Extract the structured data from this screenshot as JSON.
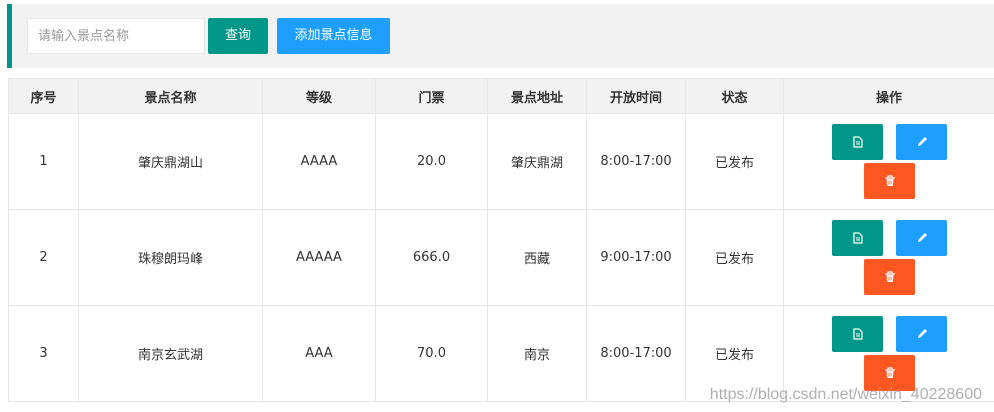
{
  "toolbar": {
    "search_placeholder": "请输入景点名称",
    "query_label": "查询",
    "add_label": "添加景点信息"
  },
  "table": {
    "headers": [
      "序号",
      "景点名称",
      "等级",
      "门票",
      "景点地址",
      "开放时间",
      "状态",
      "操作"
    ],
    "rows": [
      {
        "no": "1",
        "name": "肇庆鼎湖山",
        "level": "AAAA",
        "ticket": "20.0",
        "address": "肇庆鼎湖",
        "hours": "8:00-17:00",
        "status": "已发布"
      },
      {
        "no": "2",
        "name": "珠穆朗玛峰",
        "level": "AAAAA",
        "ticket": "666.0",
        "address": "西藏",
        "hours": "9:00-17:00",
        "status": "已发布"
      },
      {
        "no": "3",
        "name": "南京玄武湖",
        "level": "AAA",
        "ticket": "70.0",
        "address": "南京",
        "hours": "8:00-17:00",
        "status": "已发布"
      }
    ],
    "actions": {
      "view_icon": "document-icon",
      "edit_icon": "pencil-icon",
      "delete_icon": "trash-icon"
    }
  },
  "colors": {
    "accent": "#009688",
    "primary": "#1e9fff",
    "danger": "#ff5722"
  },
  "watermark": "https://blog.csdn.net/weixin_40228600"
}
